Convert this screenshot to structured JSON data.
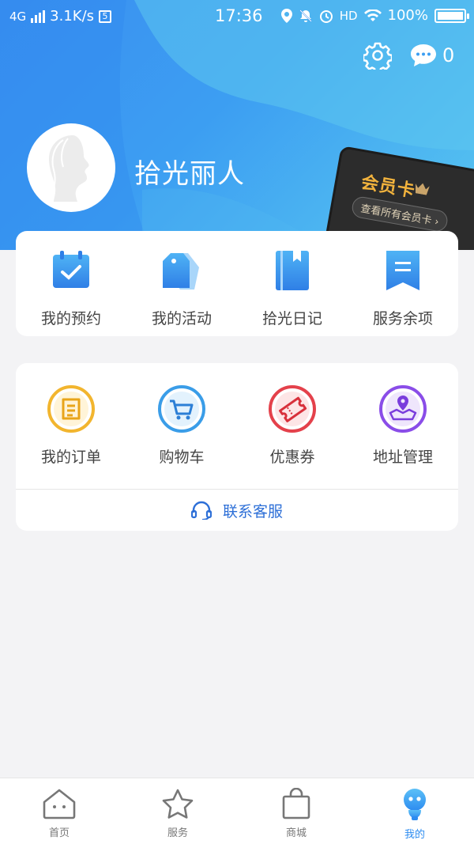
{
  "status_bar": {
    "network": "4G",
    "speed": "3.1K/s",
    "sim_badge": "5",
    "time": "17:36",
    "hd": "HD",
    "battery_text": "100%",
    "battery_level": 1.0
  },
  "header": {
    "message_count": "0",
    "username": "拾光丽人"
  },
  "member_card": {
    "title": "会员卡",
    "link": "查看所有会员卡 ›"
  },
  "quick_actions": [
    {
      "label": "我的预约",
      "icon": "calendar-check-icon"
    },
    {
      "label": "我的活动",
      "icon": "tag-icon"
    },
    {
      "label": "拾光日记",
      "icon": "diary-book-icon"
    },
    {
      "label": "服务余项",
      "icon": "bookmark-list-icon"
    }
  ],
  "orders": [
    {
      "label": "我的订单",
      "icon": "order-doc-icon",
      "color": "#f2b52e"
    },
    {
      "label": "购物车",
      "icon": "cart-icon",
      "color": "#3a9de8"
    },
    {
      "label": "优惠券",
      "icon": "coupon-icon",
      "color": "#e4414b"
    },
    {
      "label": "地址管理",
      "icon": "location-pin-icon",
      "color": "#8a4de8"
    }
  ],
  "customer_service": {
    "label": "联系客服",
    "icon": "headset-icon"
  },
  "tabbar": [
    {
      "label": "首页",
      "icon": "home-icon",
      "active": false
    },
    {
      "label": "服务",
      "icon": "star-icon",
      "active": false
    },
    {
      "label": "商城",
      "icon": "shopping-bag-icon",
      "active": false
    },
    {
      "label": "我的",
      "icon": "profile-mascot-icon",
      "active": true
    }
  ],
  "colors": {
    "accent": "#2d8cf0",
    "header_gradient_start": "#3a8ff0",
    "header_gradient_end": "#58c6f0",
    "member_gold": "#f2b33d"
  }
}
